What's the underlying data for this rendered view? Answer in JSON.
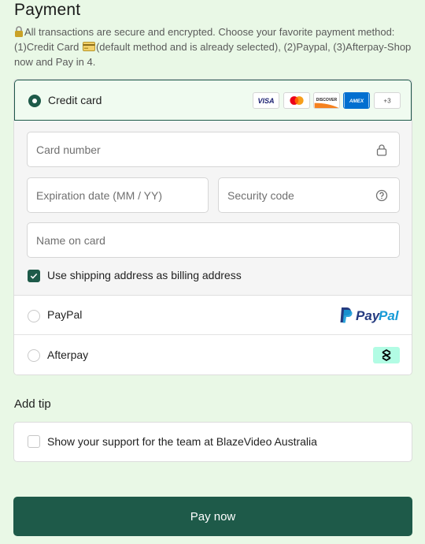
{
  "page": {
    "title": "Payment",
    "info_part1": "All transactions are secure and encrypted. Choose your favorite payment method: (1)Credit Card ",
    "info_part2": "(default method and is already selected), (2)Paypal, (3)Afterpay-Shop now and Pay in 4."
  },
  "payment": {
    "credit_card": {
      "label": "Credit card",
      "selected": true,
      "brands": [
        "VISA",
        "mastercard",
        "DISCOVER",
        "AMEX"
      ],
      "more_label": "+3"
    },
    "form": {
      "card_number_placeholder": "Card number",
      "expiration_placeholder": "Expiration date (MM / YY)",
      "security_code_placeholder": "Security code",
      "name_placeholder": "Name on card",
      "billing_checkbox_label": "Use shipping address as billing address",
      "billing_checked": true
    },
    "paypal": {
      "label": "PayPal",
      "logo_text_1": "Pay",
      "logo_text_2": "Pal"
    },
    "afterpay": {
      "label": "Afterpay"
    }
  },
  "tip": {
    "title": "Add tip",
    "checkbox_label": "Show your support for the team at BlazeVideo Australia",
    "checked": false
  },
  "actions": {
    "pay_label": "Pay now"
  },
  "colors": {
    "accent": "#1e5a49",
    "background": "#e9f8e6",
    "afterpay": "#b2fce4",
    "paypal_dark": "#253b80",
    "paypal_light": "#179bd7"
  }
}
